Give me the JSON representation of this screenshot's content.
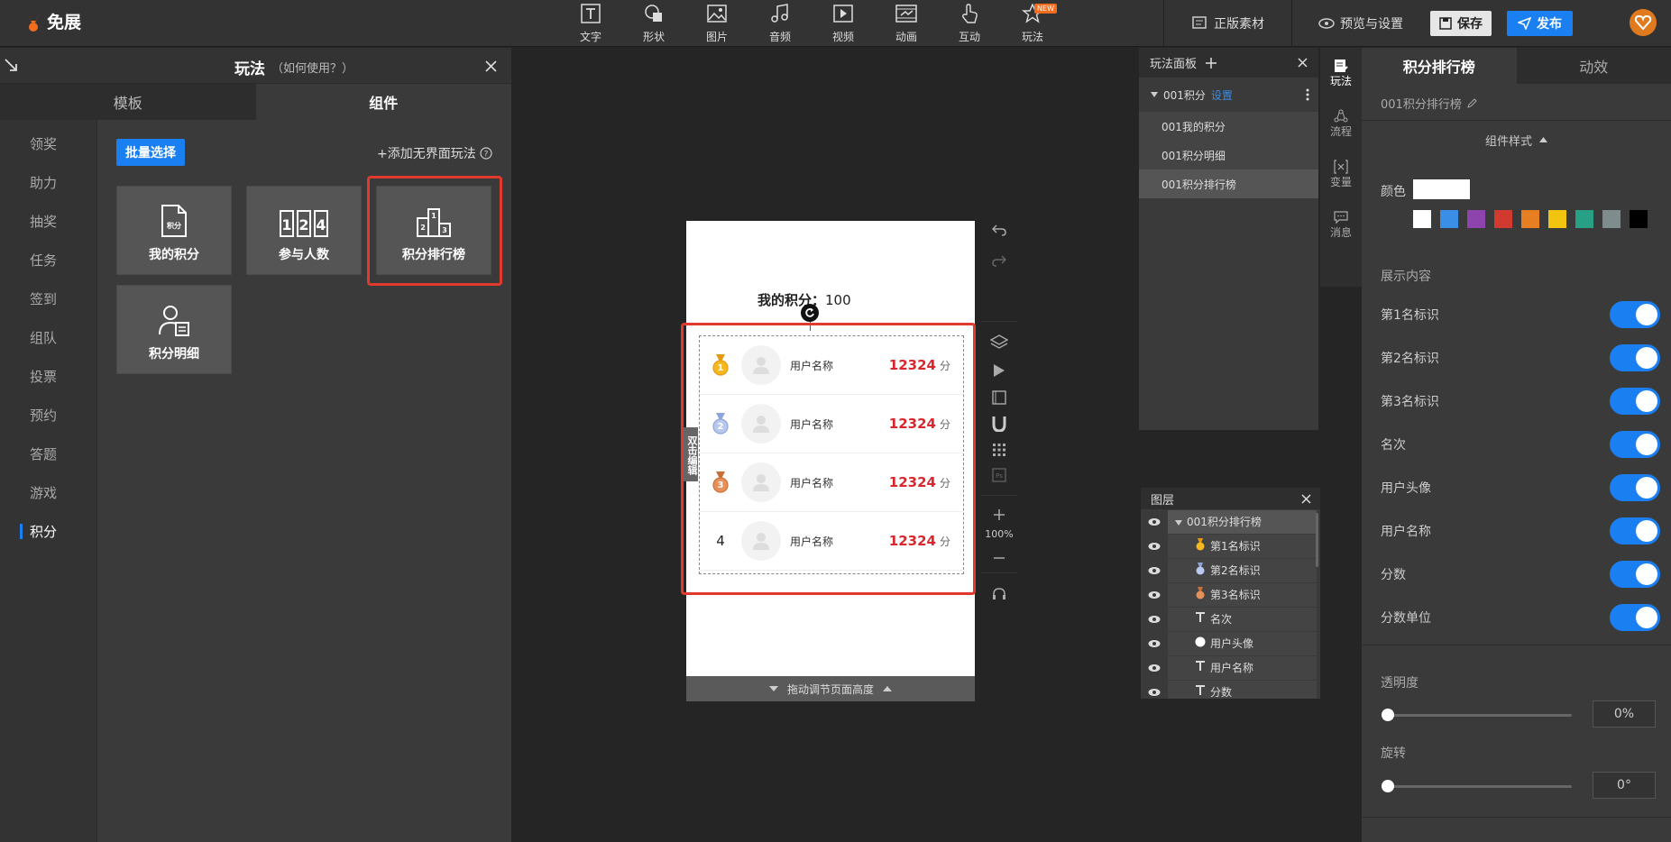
{
  "app": {
    "logo_text": "免展"
  },
  "toolbar": {
    "tools": [
      {
        "label": "文字",
        "icon": "text-icon"
      },
      {
        "label": "形状",
        "icon": "shape-icon"
      },
      {
        "label": "图片",
        "icon": "image-icon"
      },
      {
        "label": "音频",
        "icon": "music-icon"
      },
      {
        "label": "视频",
        "icon": "video-icon"
      },
      {
        "label": "动画",
        "icon": "animation-icon"
      },
      {
        "label": "互动",
        "icon": "hand-icon"
      },
      {
        "label": "玩法",
        "icon": "star-icon",
        "badge": "NEW"
      }
    ],
    "licensed_assets": "正版素材",
    "preview_settings": "预览与设置",
    "save": "保存",
    "publish": "发布"
  },
  "left_panel": {
    "title": "玩法",
    "help": "（如何使用？）",
    "tabs": [
      "模板",
      "组件"
    ],
    "active_tab": 1,
    "categories": [
      "领奖",
      "助力",
      "抽奖",
      "任务",
      "签到",
      "组队",
      "投票",
      "预约",
      "答题",
      "游戏",
      "积分"
    ],
    "active_category": 10,
    "batch_select": "批量选择",
    "add_headless": "+添加无界面玩法",
    "components": [
      "我的积分",
      "参与人数",
      "积分排行榜",
      "积分明细"
    ]
  },
  "canvas": {
    "my_points_label": "我的积分：",
    "my_points_value": "100",
    "double_click_edit": "双击编辑",
    "rows": [
      {
        "rank": "1",
        "name": "用户名称",
        "score": "12324",
        "unit": "分",
        "medal": "gold"
      },
      {
        "rank": "2",
        "name": "用户名称",
        "score": "12324",
        "unit": "分",
        "medal": "silver"
      },
      {
        "rank": "3",
        "name": "用户名称",
        "score": "12324",
        "unit": "分",
        "medal": "bronze"
      },
      {
        "rank": "4",
        "name": "用户名称",
        "score": "12324",
        "unit": "分",
        "medal": ""
      }
    ],
    "drag_adjust": "拖动调节页面高度",
    "zoom": "100%"
  },
  "play_panel": {
    "title": "玩法面板",
    "group": "001积分",
    "settings": "设置",
    "items": [
      "001我的积分",
      "001积分明细",
      "001积分排行榜"
    ],
    "active_item": 2
  },
  "vertical_nav": [
    "玩法",
    "流程",
    "变量",
    "消息"
  ],
  "layers": {
    "title": "图层",
    "items": [
      {
        "label": "001积分排行榜",
        "icon": "caret-down-icon"
      },
      {
        "label": "第1名标识",
        "icon": "gold-medal-icon"
      },
      {
        "label": "第2名标识",
        "icon": "silver-medal-icon"
      },
      {
        "label": "第3名标识",
        "icon": "bronze-medal-icon"
      },
      {
        "label": "名次",
        "icon": "text-t-icon"
      },
      {
        "label": "用户头像",
        "icon": "circle-icon"
      },
      {
        "label": "用户名称",
        "icon": "text-t-icon"
      },
      {
        "label": "分数",
        "icon": "text-t-icon"
      }
    ]
  },
  "right_panel": {
    "tabs": [
      "积分排行榜",
      "动效"
    ],
    "active_tab": 0,
    "component_name": "001积分排行榜",
    "section_style": "组件样式",
    "color_label": "颜色",
    "swatches": [
      "#ffffff",
      "#3a8ee6",
      "#8e44ad",
      "#d03a2f",
      "#e67e22",
      "#f1c40f",
      "#27a085",
      "#7f8c8d",
      "#000000"
    ],
    "display_label": "展示内容",
    "toggles": [
      "第1名标识",
      "第2名标识",
      "第3名标识",
      "名次",
      "用户头像",
      "用户名称",
      "分数",
      "分数单位"
    ],
    "opacity_label": "透明度",
    "opacity_value": "0%",
    "rotate_label": "旋转",
    "rotate_value": "0°"
  }
}
